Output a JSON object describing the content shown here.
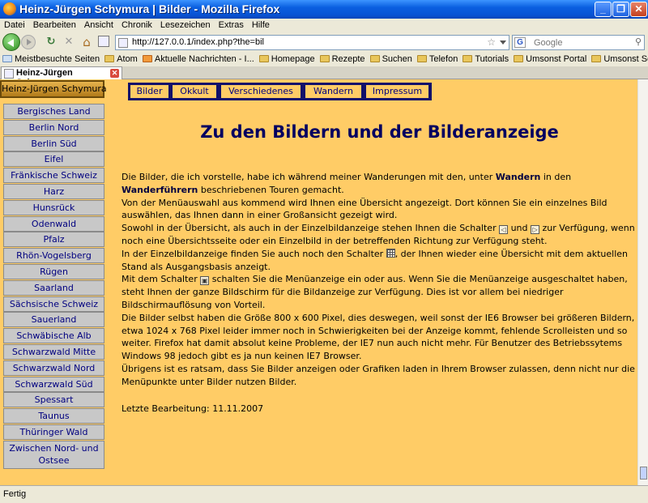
{
  "window": {
    "title": "Heinz-Jürgen Schymura | Bilder - Mozilla Firefox",
    "minimize": "_",
    "maximize": "❐",
    "close": "✕"
  },
  "menubar": [
    "Datei",
    "Bearbeiten",
    "Ansicht",
    "Chronik",
    "Lesezeichen",
    "Extras",
    "Hilfe"
  ],
  "navigation": {
    "url": "http://127.0.0.1/index.php?the=bil",
    "search_placeholder": "Google",
    "reload_icon": "↻",
    "stop_icon": "✕",
    "home_icon": "⌂",
    "star_icon": "☆"
  },
  "bookmarks": [
    "Meistbesuchte Seiten",
    "Atom",
    "Aktuelle Nachrichten - I...",
    "Homepage",
    "Rezepte",
    "Suchen",
    "Telefon",
    "Tutorials",
    "Umsonst Portal",
    "Umsonst Software"
  ],
  "tab": {
    "label": "Heinz-Jürgen Schymura..."
  },
  "page": {
    "brand": "Heinz-Jürgen Schymura",
    "top_menu": [
      "Bilder",
      "Okkult",
      "Verschiedenes",
      "Wandern",
      "Impressum"
    ],
    "side_menu": [
      "Bergisches Land",
      "Berlin Nord",
      "Berlin Süd",
      "Eifel",
      "Fränkische Schweiz",
      "Harz",
      "Hunsrück",
      "Odenwald",
      "Pfalz",
      "Rhön-Vogelsberg",
      "Rügen",
      "Saarland",
      "Sächsische Schweiz",
      "Sauerland",
      "Schwäbische Alb",
      "Schwarzwald Mitte",
      "Schwarzwald Nord",
      "Schwarzwald Süd",
      "Spessart",
      "Taunus",
      "Thüringer Wald"
    ],
    "side_menu_last": "Zwischen Nord- und Ostsee",
    "heading": "Zu den Bildern und der Bilderanzeige",
    "p1_a": "Die Bilder, die ich vorstelle, habe ich während meiner Wanderungen mit den, unter ",
    "p1_b": "Wandern",
    "p1_c": " in den ",
    "p1_d": "Wanderführern",
    "p1_e": " beschriebenen Touren gemacht.",
    "p2": "Von der Menüauswahl aus kommend wird Ihnen eine Übersicht angezeigt. Dort können Sie ein einzelnes Bild auswählen, das Ihnen dann in einer Großansicht gezeigt wird.",
    "p3_a": "Sowohl in der Übersicht, als auch in der Einzelbildanzeige stehen Ihnen die Schalter ",
    "p3_b": " und ",
    "p3_c": " zur Verfügung, wenn noch eine Übersichtsseite oder ein Einzelbild in der betreffenden Richtung zur Verfügung  steht.",
    "p4_a": "In der Einzelbildanzeige finden Sie auch noch den Schalter ",
    "p4_b": ", der Ihnen wieder eine Übersicht mit dem aktuellen Stand als Ausgangsbasis anzeigt.",
    "p5_a": "Mit dem Schalter ",
    "p5_b": " schalten Sie die Menüanzeige ein oder aus. Wenn Sie die Menüanzeige ausgeschaltet haben, steht Ihnen der ganze Bildschirm für die Bildanzeige zur Verfügung. Dies ist vor allem bei niedriger Bildschirmauflösung von Vorteil.",
    "p6": "Die Bilder selbst haben die Größe 800 x 600 Pixel, dies deswegen, weil sonst der IE6 Browser bei größeren Bildern, etwa 1024 x 768 Pixel leider immer noch in Schwierigkeiten bei der Anzeige kommt, fehlende Scrolleisten und so weiter. Firefox hat damit absolut keine Probleme, der IE7 nun auch nicht mehr. Für Benutzer des Betriebssytems Windows 98 jedoch gibt es ja nun keinen IE7 Browser.",
    "p7": "Übrigens ist es ratsam, dass Sie Bilder anzeigen oder Grafiken laden in Ihrem Browser zulassen, denn nicht nur die Menüpunkte unter Bilder nutzen Bilder.",
    "updated": "Letzte Bearbeitung: 11.11.2007"
  },
  "status": "Fertig",
  "colors": {
    "page_bg": "#ffcc66",
    "nav_item_bg": "#c8c8c8",
    "link": "#000080",
    "heading": "#000060"
  }
}
